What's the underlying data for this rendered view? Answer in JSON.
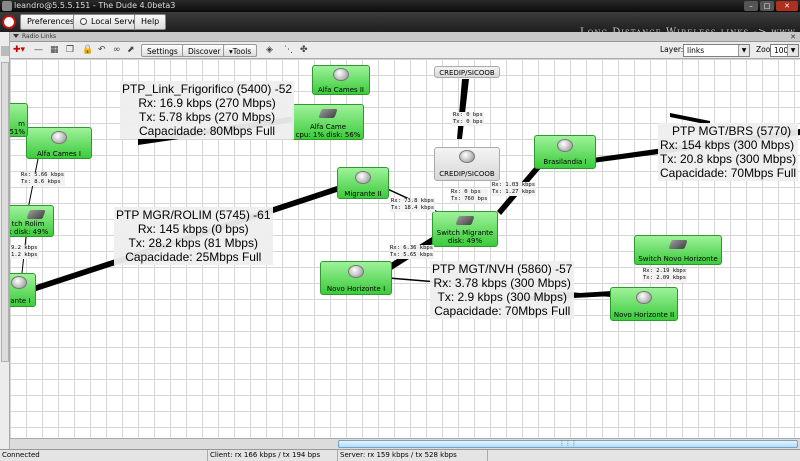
{
  "window": {
    "title": "leandro@5.5.5.151 - The Dude 4.0beta3"
  },
  "menubar": {
    "buttons": [
      "Preferences",
      "Local Server",
      "Help"
    ],
    "banner": "Long Distance Wireless links -> www"
  },
  "panel": {
    "title": "Radio Links"
  },
  "toolbar": {
    "settings": "Settings",
    "discover": "Discover",
    "tools": "Tools",
    "layer_label": "Layer:",
    "layer_value": "links",
    "zoom_label": "Zoom:",
    "zoom_value": "100%"
  },
  "nodes": [
    {
      "id": "alfa-cames-ii",
      "label": "Alfa Cames II",
      "kind": "dish"
    },
    {
      "id": "alfa-came",
      "label": "Alfa Came",
      "stat": "cpu: 1% disk: 56%",
      "kind": "switch"
    },
    {
      "id": "alfa-cames-i",
      "label": "Alfa Cames I",
      "kind": "dish"
    },
    {
      "id": "edge-top",
      "label": "m",
      "stat": "51%",
      "kind": "none"
    },
    {
      "id": "switch-rolim",
      "label": "tch Rolim",
      "stat": "k disk: 49%",
      "kind": "switch"
    },
    {
      "id": "edge-bottom",
      "label": "rante I",
      "kind": "dish"
    },
    {
      "id": "credip-top",
      "label": "CREDIP/SICOOB",
      "kind": "none"
    },
    {
      "id": "credip",
      "label": "CREDIP/SICOOB",
      "kind": "dish"
    },
    {
      "id": "migrante-ii",
      "label": "Migrante II",
      "kind": "dish"
    },
    {
      "id": "brasilandia-i",
      "label": "Brasilandia I",
      "kind": "dish"
    },
    {
      "id": "switch-migrante",
      "label": "Switch Migrante",
      "stat": "disk: 49%",
      "kind": "switch"
    },
    {
      "id": "novo-horizonte-i",
      "label": "Novo Horizonte I",
      "kind": "dish"
    },
    {
      "id": "switch-novo-horizonte",
      "label": "Switch Novo Horizonte",
      "kind": "switch"
    },
    {
      "id": "novo-horizonte-ii",
      "label": "Novo Horizonte II",
      "kind": "dish"
    }
  ],
  "link_labels": [
    {
      "id": "rolim",
      "rx": "Rx: 5.66 kbps",
      "tx": "Tx: 8.6 kbps"
    },
    {
      "id": "rolim-bottom",
      "rx": "9.2 kbps",
      "tx": "1.2 kbps"
    },
    {
      "id": "credip",
      "rx": "Rx: 0 bps",
      "tx": "Tx: 0 bps"
    },
    {
      "id": "credip-mig",
      "rx": "Rx: 0 bps",
      "tx": "Tx: 760 bps"
    },
    {
      "id": "migrante",
      "rx": "Rx: 73.8 kbps",
      "tx": "Tx: 18.4 kbps"
    },
    {
      "id": "brasilandia",
      "rx": "Rx: 1.03 kbps",
      "tx": "Tx: 1.27 kbps"
    },
    {
      "id": "novo-h",
      "rx": "Rx: 6.36 kbps",
      "tx": "Tx: 5.65 kbps"
    },
    {
      "id": "novo-h2",
      "rx": "Rx: 2.19 kbps",
      "tx": "Tx: 2.09 kbps"
    }
  ],
  "annotations": [
    {
      "id": "frigorifico",
      "lines": [
        "PTP_Link_Frigorifico (5400) -52",
        "Rx: 16.9 kbps (270 Mbps)",
        "Tx: 5.78 kbps (270 Mbps)",
        "Capacidade: 80Mbps Full"
      ]
    },
    {
      "id": "mgr-rolim",
      "lines": [
        "PTP MGR/ROLIM (5745) -61",
        "Rx: 145 kbps (0 bps)",
        "Tx: 28.2 kbps (81 Mbps)",
        "Capacidade: 25Mbps Full"
      ]
    },
    {
      "id": "mgt-nvh",
      "lines": [
        "PTP MGT/NVH (5860) -57",
        "Rx: 3.78 kbps (300 Mbps)",
        "Tx: 2.9 kbps (300 Mbps)",
        "Capacidade: 70Mbps Full"
      ]
    },
    {
      "id": "mgt-brs",
      "lines": [
        "PTP MGT/BRS (5770)",
        "Rx: 154 kbps (300 Mbps)",
        "Tx: 20.8 kbps (300 Mbps)",
        "Capacidade: 70Mbps Full"
      ]
    }
  ],
  "status": {
    "state": "Connected",
    "client": "Client: rx 166 kbps / tx 194 bps",
    "server": "Server: rx 159 kbps / tx 528 kbps"
  }
}
